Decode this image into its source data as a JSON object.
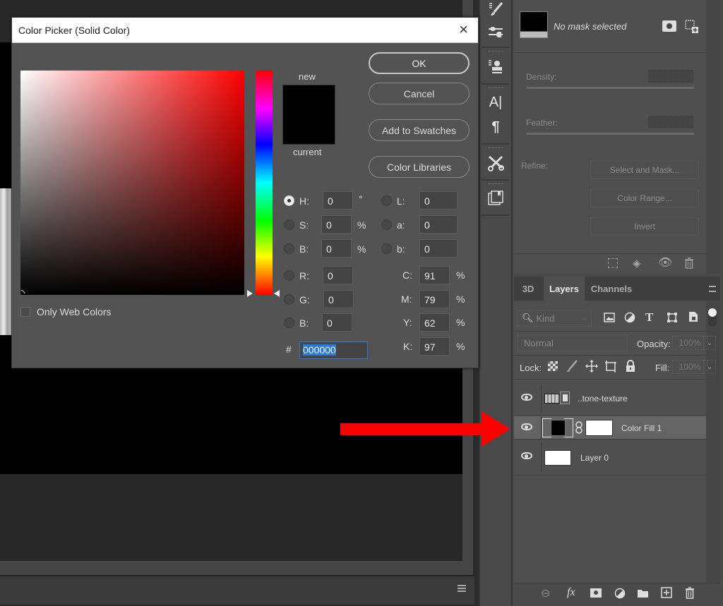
{
  "dialog": {
    "title": "Color Picker (Solid Color)",
    "close_icon": "×",
    "buttons": {
      "ok": "OK",
      "cancel": "Cancel",
      "add_swatches": "Add to Swatches",
      "color_libraries": "Color Libraries"
    },
    "swatch": {
      "new_label": "new",
      "current_label": "current",
      "new_color": "#000000",
      "current_color": "#000000"
    },
    "only_web_colors": {
      "label": "Only Web Colors",
      "checked": false
    },
    "fields": {
      "H": {
        "label": "H:",
        "value": "0",
        "unit": "°",
        "selected": true
      },
      "S": {
        "label": "S:",
        "value": "0",
        "unit": "%"
      },
      "Bhsb": {
        "label": "B:",
        "value": "0",
        "unit": "%"
      },
      "R": {
        "label": "R:",
        "value": "0"
      },
      "G": {
        "label": "G:",
        "value": "0"
      },
      "Brgb": {
        "label": "B:",
        "value": "0"
      },
      "L": {
        "label": "L:",
        "value": "0"
      },
      "a": {
        "label": "a:",
        "value": "0"
      },
      "b": {
        "label": "b:",
        "value": "0"
      },
      "C": {
        "label": "C:",
        "value": "91",
        "unit": "%"
      },
      "M": {
        "label": "M:",
        "value": "79",
        "unit": "%"
      },
      "Y": {
        "label": "Y:",
        "value": "62",
        "unit": "%"
      },
      "K": {
        "label": "K:",
        "value": "97",
        "unit": "%"
      },
      "hex": {
        "label": "#",
        "value": "000000"
      }
    },
    "hue_degrees": 0
  },
  "tools": [
    {
      "icon": "brush-presets-icon"
    },
    {
      "icon": "adjustments-icon"
    },
    {
      "icon": "clone-source-icon"
    },
    {
      "icon": "character-icon",
      "glyph": "A|"
    },
    {
      "icon": "paragraph-icon",
      "glyph": "¶"
    },
    {
      "icon": "tool-presets-icon"
    },
    {
      "icon": "libraries-icon"
    }
  ],
  "properties": {
    "mask_text": "No mask selected",
    "density_label": "Density:",
    "feather_label": "Feather:",
    "refine_label": "Refine:",
    "select_and_mask": "Select and Mask...",
    "color_range": "Color Range...",
    "invert": "Invert"
  },
  "layers_panel": {
    "tabs": [
      "3D",
      "Layers",
      "Channels"
    ],
    "active_tab": "Layers",
    "kind_label": "Kind",
    "blend_mode": "Normal",
    "opacity_label": "Opacity:",
    "opacity_value": "100%",
    "lock_label": "Lock:",
    "fill_label": "Fill:",
    "fill_value": "100%",
    "layers": [
      {
        "name": "..tone-texture",
        "visible": true,
        "selected": false,
        "type": "smart-object"
      },
      {
        "name": "Color Fill 1",
        "visible": true,
        "selected": true,
        "type": "fill",
        "fill_color": "#000000"
      },
      {
        "name": "Layer 0",
        "visible": true,
        "selected": false,
        "type": "pixel"
      }
    ]
  },
  "annotation": {
    "arrow_color": "#ff0000",
    "points_to": "Color Fill 1"
  }
}
